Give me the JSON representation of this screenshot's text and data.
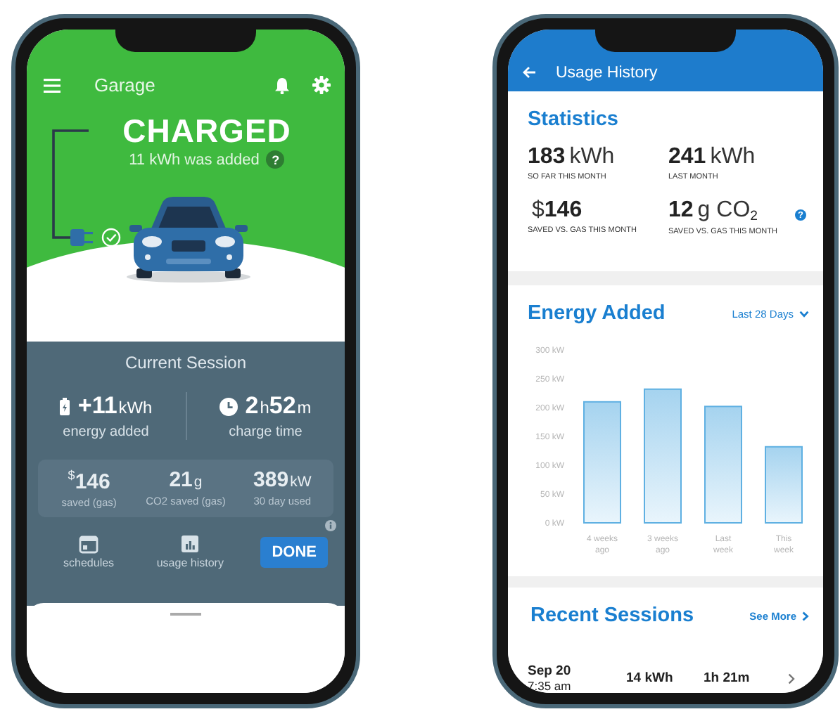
{
  "garage_screen": {
    "app_bar": {
      "title": "Garage"
    },
    "status": {
      "headline": "CHARGED",
      "summary": "11 kWh was added",
      "help_mark": "?"
    },
    "current_session": {
      "title": "Current Session",
      "primary": [
        {
          "parts": [
            {
              "text": "+11",
              "kind": "num"
            },
            {
              "text": "kWh",
              "kind": "unit"
            }
          ],
          "label": "energy added"
        },
        {
          "parts": [
            {
              "text": "2",
              "kind": "num"
            },
            {
              "text": "h",
              "kind": "unit"
            },
            {
              "text": "52",
              "kind": "num"
            },
            {
              "text": "m",
              "kind": "unit"
            }
          ],
          "label": "charge time"
        }
      ],
      "secondary": [
        {
          "parts": [
            {
              "text": "$",
              "kind": "sup"
            },
            {
              "text": "146",
              "kind": "num"
            }
          ],
          "label": "saved (gas)"
        },
        {
          "parts": [
            {
              "text": "21",
              "kind": "num"
            },
            {
              "text": "g",
              "kind": "unit"
            }
          ],
          "label": "CO2 saved (gas)"
        },
        {
          "parts": [
            {
              "text": "389",
              "kind": "num"
            },
            {
              "text": "kW",
              "kind": "unit"
            }
          ],
          "label": "30 day used"
        }
      ],
      "actions": [
        {
          "label": "schedules"
        },
        {
          "label": "usage history"
        }
      ],
      "done_button": "DONE"
    }
  },
  "usage_screen": {
    "app_bar": {
      "title": "Usage History"
    },
    "statistics": {
      "title": "Statistics",
      "help_mark": "?",
      "items": [
        {
          "parts": [
            {
              "text": "183",
              "kind": "num"
            },
            {
              "text": "kWh",
              "kind": "unit"
            }
          ],
          "caption": "SO FAR THIS MONTH"
        },
        {
          "parts": [
            {
              "text": "241",
              "kind": "num"
            },
            {
              "text": "kWh",
              "kind": "unit"
            }
          ],
          "caption": "LAST MONTH"
        },
        {
          "parts": [
            {
              "text": "$",
              "kind": "unit"
            },
            {
              "text": "146",
              "kind": "num"
            }
          ],
          "caption": "SAVED VS. GAS THIS MONTH"
        },
        {
          "parts": [
            {
              "text": "12",
              "kind": "num"
            },
            {
              "text": "g CO",
              "kind": "unit"
            },
            {
              "text": "2",
              "kind": "sub"
            }
          ],
          "caption": "SAVED VS. GAS THIS MONTH"
        }
      ]
    },
    "energy_added": {
      "title": "Energy Added",
      "range": "Last 28 Days",
      "chart_data": {
        "type": "bar",
        "categories": [
          "4 weeks ago",
          "3 weeks ago",
          "Last week",
          "This week"
        ],
        "values": [
          210,
          232,
          202,
          132
        ],
        "ylim": [
          0,
          300
        ],
        "yticks": [
          {
            "value": 0,
            "label": "0 kW"
          },
          {
            "value": 50,
            "label": "50 kW"
          },
          {
            "value": 100,
            "label": "100 kW"
          },
          {
            "value": 150,
            "label": "150 kW"
          },
          {
            "value": 200,
            "label": "200 kW"
          },
          {
            "value": 250,
            "label": "250 kW"
          },
          {
            "value": 300,
            "label": "300 kW"
          }
        ]
      }
    },
    "recent_sessions": {
      "title": "Recent Sessions",
      "see_more": "See More",
      "rows": [
        {
          "date": "Sep 20",
          "time": "7:35 am",
          "energy": "14 kWh",
          "duration": "1h 21m"
        }
      ]
    }
  }
}
